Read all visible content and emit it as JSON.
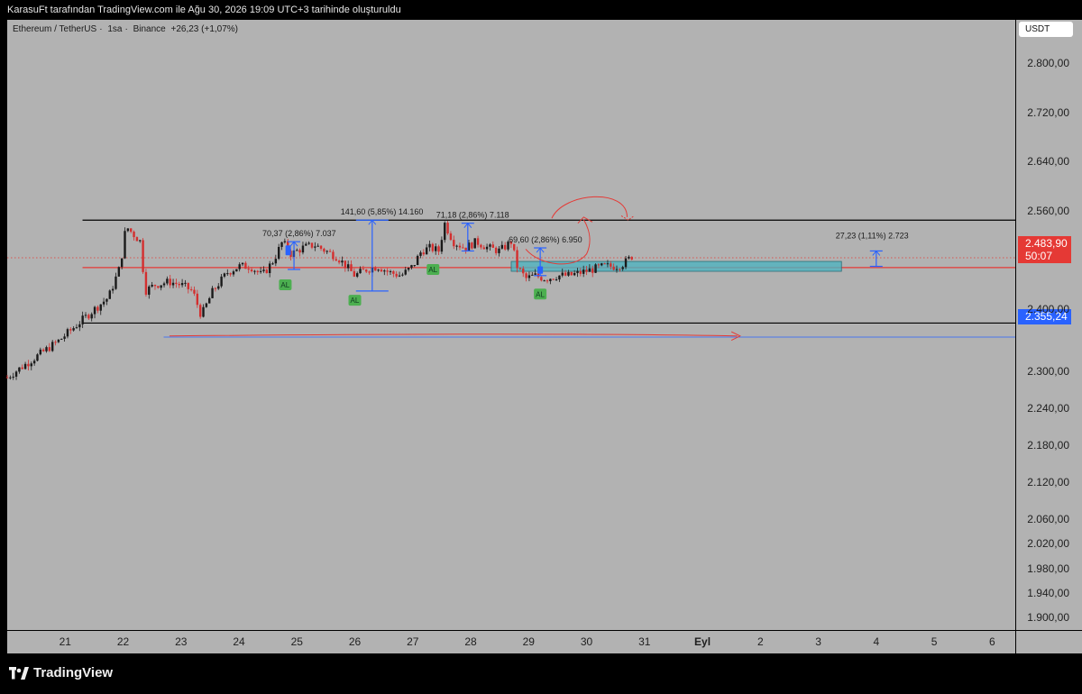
{
  "header": {
    "caption": "KarasuFt tarafından TradingView.com ile Ağu 30, 2026 19:09 UTC+3 tarihinde oluşturuldu"
  },
  "legend": {
    "symbol": "Ethereum / TetherUS",
    "interval": "1sa",
    "exchange": "Binance",
    "change": "+26,23 (+1,07%)",
    "sep": "·"
  },
  "axis": {
    "currency": "USDT"
  },
  "price_tags": {
    "current": "2.483,90",
    "countdown": "50:07",
    "level": "2.355,24"
  },
  "measures": [
    {
      "text": "70,37 (2,86%) 7.037"
    },
    {
      "text": "141,60 (5,85%) 14.160"
    },
    {
      "text": "71,18 (2,86%) 7.118"
    },
    {
      "text": "69,60 (2,86%) 6.950"
    },
    {
      "text": "27,23 (1,11%) 2.723"
    }
  ],
  "signals": {
    "label": "AL"
  },
  "brand": {
    "name": "TradingView"
  },
  "colors": {
    "background": "#b2b2b2",
    "support_resistance": "#000000",
    "mid_line": "#e53935",
    "level_line": "#2962ff",
    "zone": "#4fb3bf",
    "up": "#1a1a1a",
    "down": "#d32f2f"
  },
  "chart_data": {
    "type": "candlestick",
    "x_ticks": [
      "21",
      "22",
      "23",
      "24",
      "25",
      "26",
      "27",
      "28",
      "29",
      "30",
      "31",
      "Eyl",
      "2",
      "3",
      "4",
      "5",
      "6"
    ],
    "y_ticks": [
      "2.800,00",
      "2.720,00",
      "2.640,00",
      "2.560,00",
      "2.400,00",
      "2.300,00",
      "2.240,00",
      "2.180,00",
      "2.120,00",
      "2.060,00",
      "2.020,00",
      "1.980,00",
      "1.940,00",
      "1.900,00"
    ],
    "horizontal_lines": [
      {
        "price": 2545,
        "color": "#000000",
        "from_day": 21.3,
        "to_day": 38.5
      },
      {
        "price": 2468,
        "color": "#e53935",
        "from_day": 21.3,
        "to_day": 38.5
      },
      {
        "price": 2378,
        "color": "#000000",
        "from_day": 21.3,
        "to_day": 38.5
      },
      {
        "price": 2355.24,
        "color": "#2962ff",
        "from_day": 22.7,
        "to_day": 38.5
      }
    ],
    "zone": {
      "from_day": 28.7,
      "to_day": 34.4,
      "top": 2478,
      "bottom": 2462
    },
    "path": [
      [
        20.0,
        2290
      ],
      [
        20.3,
        2310
      ],
      [
        20.6,
        2330
      ],
      [
        20.9,
        2350
      ],
      [
        21.2,
        2375
      ],
      [
        21.5,
        2400
      ],
      [
        21.75,
        2420
      ],
      [
        21.95,
        2470
      ],
      [
        22.05,
        2535
      ],
      [
        22.2,
        2520
      ],
      [
        22.3,
        2510
      ],
      [
        22.38,
        2430
      ],
      [
        22.55,
        2440
      ],
      [
        22.8,
        2445
      ],
      [
        23.0,
        2440
      ],
      [
        23.2,
        2430
      ],
      [
        23.35,
        2390
      ],
      [
        23.55,
        2430
      ],
      [
        23.8,
        2460
      ],
      [
        24.0,
        2470
      ],
      [
        24.2,
        2470
      ],
      [
        24.4,
        2455
      ],
      [
        24.6,
        2480
      ],
      [
        24.75,
        2510
      ],
      [
        24.9,
        2490
      ],
      [
        25.1,
        2500
      ],
      [
        25.3,
        2505
      ],
      [
        25.5,
        2495
      ],
      [
        25.7,
        2485
      ],
      [
        25.9,
        2465
      ],
      [
        26.0,
        2455
      ],
      [
        26.2,
        2465
      ],
      [
        26.4,
        2470
      ],
      [
        26.6,
        2460
      ],
      [
        26.8,
        2455
      ],
      [
        27.0,
        2470
      ],
      [
        27.15,
        2495
      ],
      [
        27.3,
        2500
      ],
      [
        27.45,
        2495
      ],
      [
        27.55,
        2540
      ],
      [
        27.7,
        2510
      ],
      [
        27.9,
        2500
      ],
      [
        28.1,
        2510
      ],
      [
        28.3,
        2500
      ],
      [
        28.5,
        2495
      ],
      [
        28.7,
        2510
      ],
      [
        28.8,
        2470
      ],
      [
        28.95,
        2450
      ],
      [
        29.1,
        2455
      ],
      [
        29.3,
        2450
      ],
      [
        29.5,
        2455
      ],
      [
        29.7,
        2455
      ],
      [
        29.9,
        2460
      ],
      [
        30.1,
        2465
      ],
      [
        30.3,
        2470
      ],
      [
        30.5,
        2470
      ],
      [
        30.65,
        2475
      ],
      [
        30.8,
        2488
      ]
    ],
    "measures": [
      {
        "day": 24.95,
        "from": 2465,
        "to": 2510,
        "label_index": 0
      },
      {
        "day": 26.3,
        "from": 2430,
        "to": 2545,
        "label_index": 1
      },
      {
        "day": 27.95,
        "from": 2495,
        "to": 2540,
        "label_index": 2
      },
      {
        "day": 29.2,
        "from": 2455,
        "to": 2500,
        "label_index": 3
      },
      {
        "day": 35.0,
        "from": 2470,
        "to": 2495,
        "label_index": 4
      }
    ],
    "signals": [
      {
        "day": 24.8,
        "price": 2440
      },
      {
        "day": 26.0,
        "price": 2415
      },
      {
        "day": 27.35,
        "price": 2465
      },
      {
        "day": 29.2,
        "price": 2425
      }
    ],
    "ylim": [
      1880,
      2870
    ],
    "xlim": [
      20.0,
      37.4
    ]
  }
}
